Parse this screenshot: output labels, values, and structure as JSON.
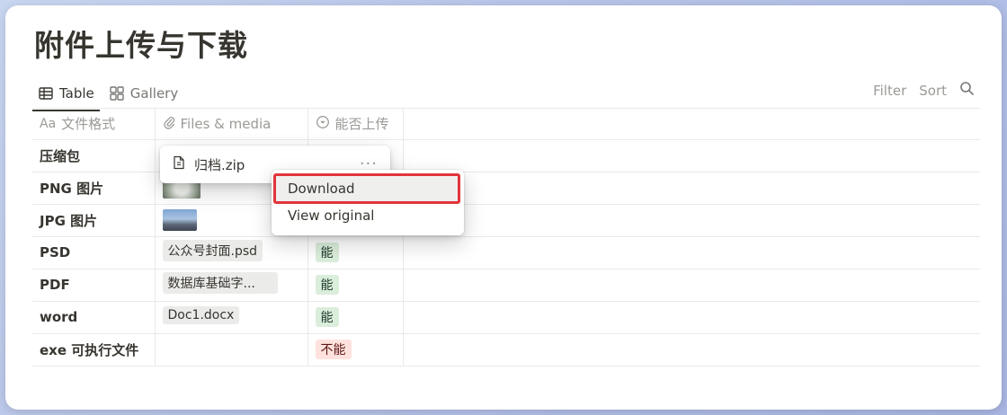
{
  "page": {
    "title": "附件上传与下载"
  },
  "views": {
    "table_label": "Table",
    "gallery_label": "Gallery"
  },
  "actions": {
    "filter": "Filter",
    "sort": "Sort"
  },
  "columns": {
    "format_prefix": "Aa",
    "format": "文件格式",
    "files": "Files & media",
    "upload": "能否上传"
  },
  "rows": [
    {
      "name": "压缩包",
      "file": "",
      "upload": ""
    },
    {
      "name": "PNG 图片",
      "file": "",
      "upload": ""
    },
    {
      "name": "JPG 图片",
      "file": "",
      "upload": ""
    },
    {
      "name": "PSD",
      "file": "公众号封面.psd",
      "upload": "能"
    },
    {
      "name": "PDF",
      "file": "数据库基础字...",
      "upload": "能"
    },
    {
      "name": "word",
      "file": "Doc1.docx",
      "upload": "能"
    },
    {
      "name": "exe 可执行文件",
      "file": "",
      "upload": "不能"
    }
  ],
  "popup": {
    "filename": "归档.zip",
    "more": "···"
  },
  "menu": {
    "download": "Download",
    "view_original": "View original"
  },
  "colors": {
    "highlight_border": "#e0353b",
    "tag_yes_bg": "#dbeddb",
    "tag_no_bg": "#ffe2dd"
  },
  "icons": [
    "table-icon",
    "gallery-icon",
    "search-icon",
    "text-type-icon",
    "paperclip-icon",
    "select-type-icon",
    "file-icon",
    "more-icon"
  ]
}
